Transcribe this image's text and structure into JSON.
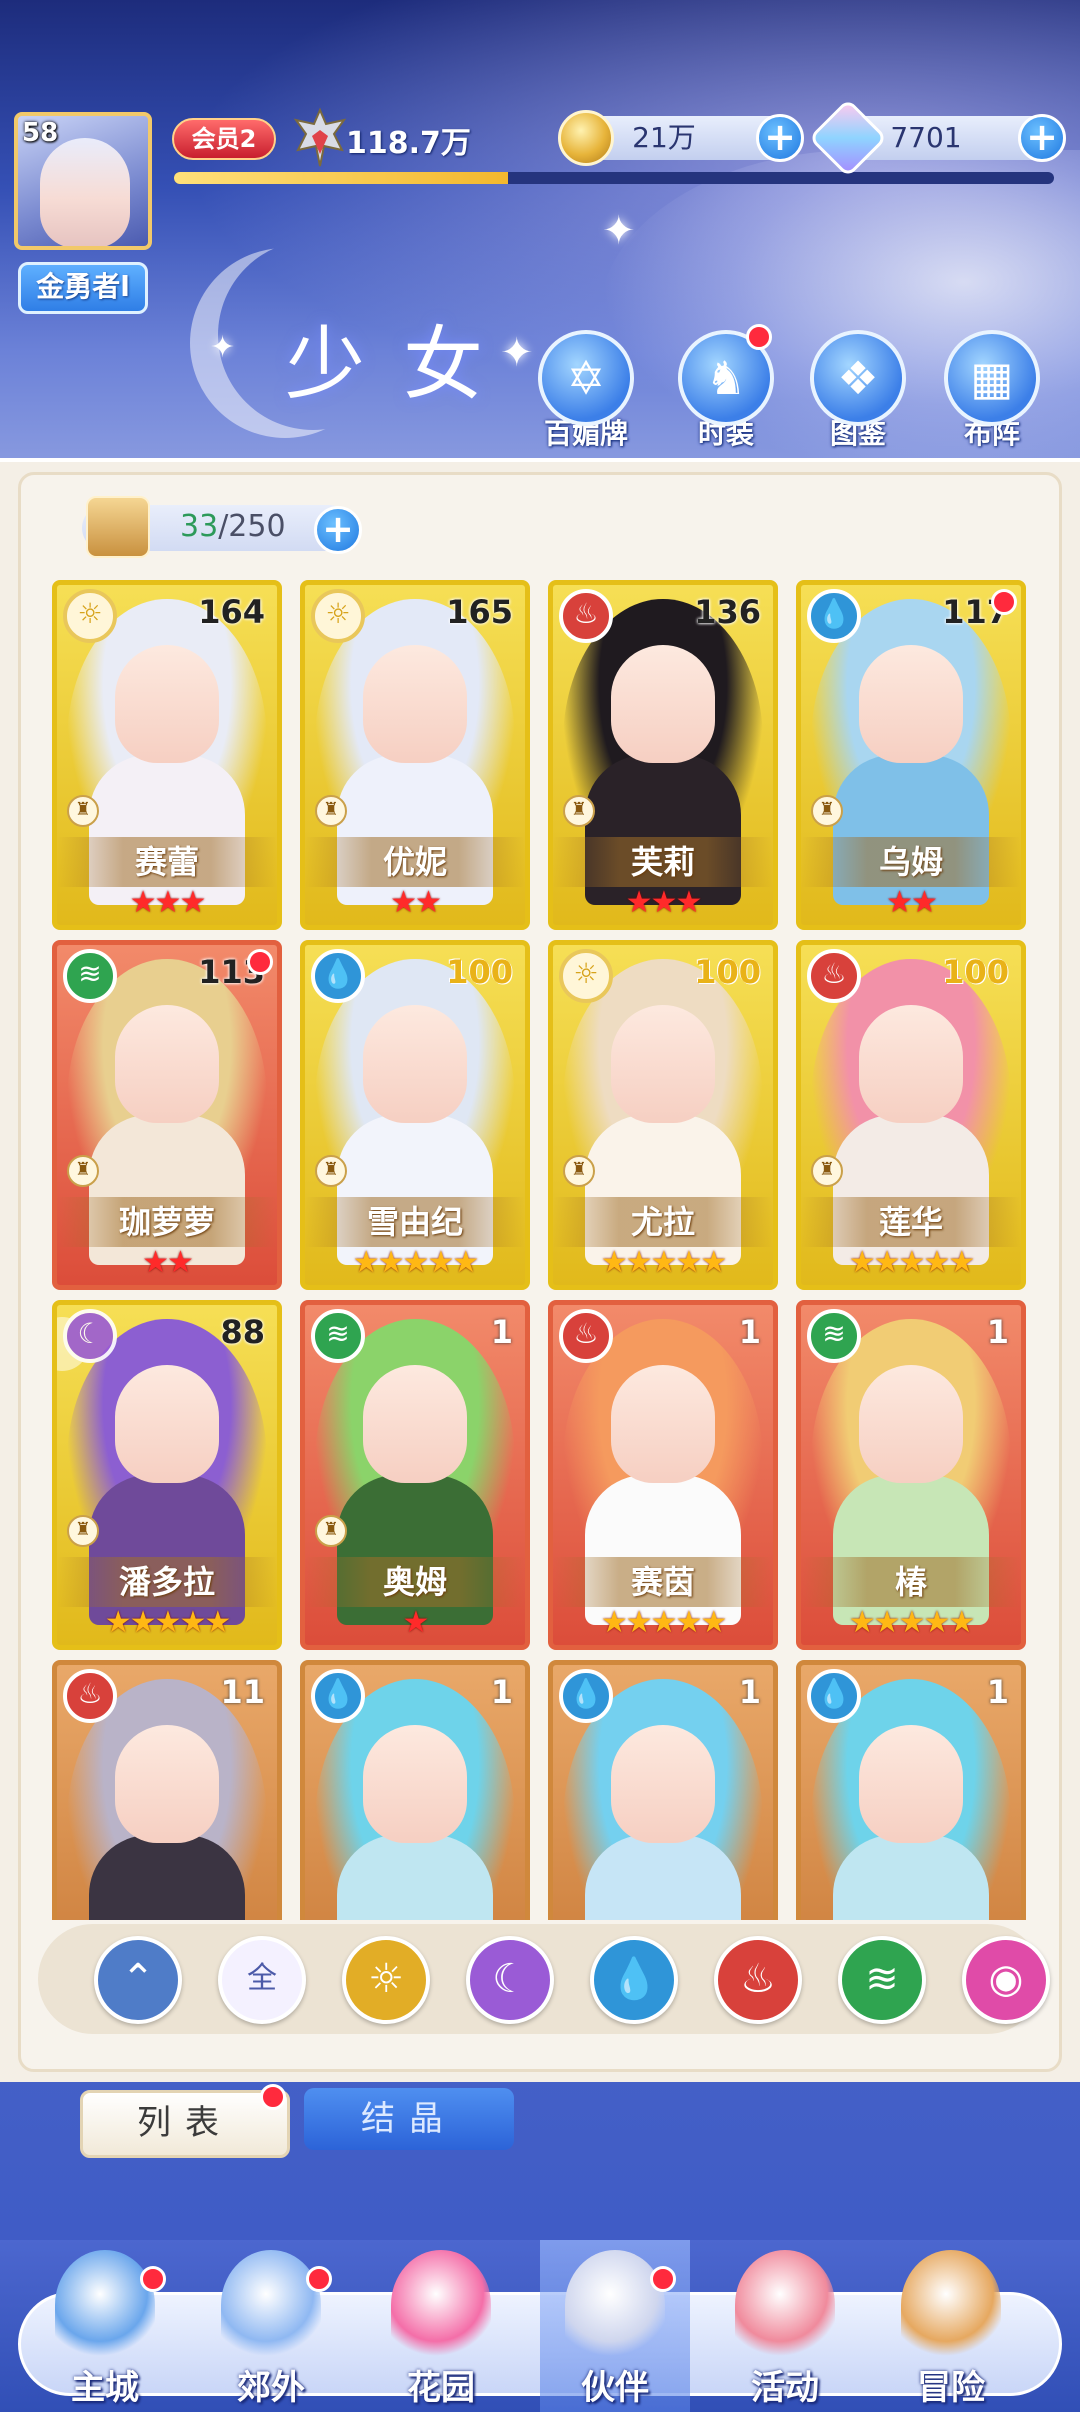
{
  "player": {
    "level": "58",
    "name": "金勇者l",
    "vip": "会员2",
    "power": "118.7万",
    "xp_fraction": 0.38
  },
  "currency": {
    "gold": "21万",
    "gems": "7701",
    "plus": "+"
  },
  "page": {
    "title": "少女"
  },
  "top_buttons": [
    {
      "label": "百媚牌",
      "icon": "card-deck-icon"
    },
    {
      "label": "时装",
      "icon": "costume-icon",
      "badge": true
    },
    {
      "label": "图鉴",
      "icon": "codex-book-icon"
    },
    {
      "label": "布阵",
      "icon": "formation-grid-icon"
    }
  ],
  "inventory": {
    "current": "33",
    "max": "/250",
    "plus": "+"
  },
  "cards": [
    {
      "name": "赛蕾",
      "level": "164",
      "element": "light",
      "stars": 3,
      "star_color": "red",
      "frame": "gold",
      "badge": false
    },
    {
      "name": "优妮",
      "level": "165",
      "element": "light",
      "stars": 2,
      "star_color": "red",
      "frame": "gold",
      "badge": false
    },
    {
      "name": "芙莉",
      "level": "136",
      "element": "fire",
      "stars": 3,
      "star_color": "red",
      "frame": "gold",
      "badge": false
    },
    {
      "name": "乌姆",
      "level": "117",
      "element": "water",
      "stars": 2,
      "star_color": "red",
      "frame": "gold",
      "badge": true
    },
    {
      "name": "珈萝萝",
      "level": "113",
      "element": "wind",
      "stars": 2,
      "star_color": "red",
      "frame": "red",
      "badge": true
    },
    {
      "name": "雪由纪",
      "level": "100",
      "element": "water",
      "stars": 5,
      "star_color": "gold",
      "frame": "gold",
      "badge": false
    },
    {
      "name": "尤拉",
      "level": "100",
      "element": "light",
      "stars": 5,
      "star_color": "gold",
      "frame": "gold",
      "badge": false
    },
    {
      "name": "莲华",
      "level": "100",
      "element": "fire",
      "stars": 5,
      "star_color": "gold",
      "frame": "gold",
      "badge": false
    },
    {
      "name": "潘多拉",
      "level": "88",
      "element": "moon",
      "stars": 5,
      "star_color": "gold",
      "frame": "gold",
      "badge": false
    },
    {
      "name": "奥姆",
      "level": "1",
      "element": "wind",
      "stars": 1,
      "star_color": "red",
      "frame": "red",
      "badge": false
    },
    {
      "name": "赛茵",
      "level": "1",
      "element": "fire",
      "stars": 5,
      "star_color": "gold",
      "frame": "red",
      "badge": false
    },
    {
      "name": "椿",
      "level": "1",
      "element": "wind",
      "stars": 5,
      "star_color": "gold",
      "frame": "red",
      "badge": false
    },
    {
      "name": "",
      "level": "11",
      "element": "fire",
      "stars": 0,
      "star_color": "gold",
      "frame": "orange",
      "badge": false
    },
    {
      "name": "",
      "level": "1",
      "element": "water",
      "stars": 0,
      "star_color": "gold",
      "frame": "orange",
      "badge": false
    },
    {
      "name": "",
      "level": "1",
      "element": "water",
      "stars": 0,
      "star_color": "gold",
      "frame": "orange",
      "badge": false
    },
    {
      "name": "",
      "level": "1",
      "element": "water",
      "stars": 0,
      "star_color": "gold",
      "frame": "orange",
      "badge": false
    }
  ],
  "filters": [
    {
      "id": "collapse",
      "label": "",
      "icon": "collapse-arrow-icon",
      "color": "#4f7cc8"
    },
    {
      "id": "all",
      "label": "全",
      "icon": "all-filter-icon",
      "color": "#f4f1ff"
    },
    {
      "id": "light",
      "label": "",
      "icon": "sun-icon",
      "color": "#e2ad26"
    },
    {
      "id": "moon",
      "label": "",
      "icon": "crescent-moon-icon",
      "color": "#9a5bd6"
    },
    {
      "id": "water",
      "label": "",
      "icon": "water-drop-icon",
      "color": "#2f95d8"
    },
    {
      "id": "fire",
      "label": "",
      "icon": "flame-icon",
      "color": "#d8413b"
    },
    {
      "id": "wind",
      "label": "",
      "icon": "whirlwind-icon",
      "color": "#2fa450"
    },
    {
      "id": "spirit",
      "label": "",
      "icon": "spirit-orb-icon",
      "color": "#e04ba8"
    }
  ],
  "tabs": {
    "list": "列表",
    "crystal": "结晶"
  },
  "nav": [
    {
      "label": "主城",
      "icon": "castle-icon",
      "badge": true
    },
    {
      "label": "郊外",
      "icon": "magic-circle-icon",
      "badge": true
    },
    {
      "label": "花园",
      "icon": "heart-garden-icon",
      "badge": false
    },
    {
      "label": "伙伴",
      "icon": "partner-avatar-icon",
      "badge": true,
      "active": true
    },
    {
      "label": "活动",
      "icon": "gift-box-icon",
      "badge": false
    },
    {
      "label": "冒险",
      "icon": "compass-icon",
      "badge": false
    }
  ],
  "colors": {
    "accent": "#2f7ee6",
    "badge": "#ff2a3d",
    "gold_frame": "#e5bf18",
    "red_frame": "#e2603f"
  }
}
